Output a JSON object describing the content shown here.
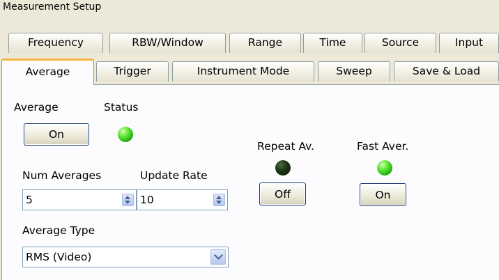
{
  "window": {
    "title": "Measurement Setup"
  },
  "tabs": {
    "row1": [
      "Frequency",
      "RBW/Window",
      "Range",
      "Time",
      "Source",
      "Input"
    ],
    "row2": [
      "Average",
      "Trigger",
      "Instrument Mode",
      "Sweep",
      "Save & Load"
    ],
    "active": "Average"
  },
  "average": {
    "average_label": "Average",
    "status_label": "Status",
    "average_button": "On",
    "status_led": "on",
    "num_averages_label": "Num Averages",
    "num_averages_value": "5",
    "update_rate_label": "Update Rate",
    "update_rate_value": "10",
    "average_type_label": "Average Type",
    "average_type_value": "RMS (Video)",
    "repeat_label": "Repeat Av.",
    "repeat_led": "off",
    "repeat_button": "Off",
    "fast_label": "Fast Aver.",
    "fast_led": "on",
    "fast_button": "On"
  },
  "colors": {
    "background": "#ece9d8",
    "panel": "#fcfcfe",
    "active_tab_accent": "#f4b23f",
    "led_on": "#5fe83a",
    "led_off": "#1b3314",
    "border": "#919b9c"
  }
}
